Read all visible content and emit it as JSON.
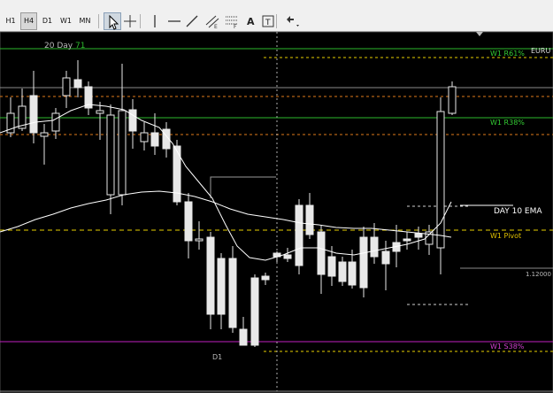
{
  "toolbar": {
    "timeframes": [
      "H1",
      "H4",
      "D1",
      "W1",
      "MN"
    ],
    "active_timeframe": "H4",
    "tools": [
      {
        "name": "cursor-icon",
        "active": true
      },
      {
        "name": "crosshair-icon",
        "active": false
      },
      {
        "name": "vertical-line-icon",
        "active": false
      },
      {
        "name": "horizontal-line-icon",
        "active": false
      },
      {
        "name": "trendline-icon",
        "active": false
      },
      {
        "name": "equidistant-channel-icon",
        "active": false
      },
      {
        "name": "fibonacci-icon",
        "active": false
      },
      {
        "name": "text-icon",
        "active": false
      },
      {
        "name": "text-label-icon",
        "active": false
      },
      {
        "name": "arrows-dropdown-icon",
        "active": false
      }
    ],
    "text_tool_glyph": "A"
  },
  "chart": {
    "top_label": "20 Day",
    "top_label_value": "71",
    "symbol_label": "EURU",
    "d1_label": "D1",
    "price_tick": "1.12000",
    "colors": {
      "background": "#000000",
      "candle": "#e8e8e8",
      "ema": "#ffffff",
      "sma20": "#ffffff",
      "green_level": "#2db82d",
      "magenta_level": "#c020c0",
      "orange_dotted": "#e07a1a",
      "yellow_dotted": "#e8d000",
      "white_dotted": "#cfcfcf",
      "grey_line": "#8a8a8a"
    },
    "levels": [
      {
        "label": "W1 R61%",
        "color": "#33cc33"
      },
      {
        "label": "W1 R38%",
        "color": "#33cc33"
      },
      {
        "label": "DAY 10 EMA",
        "color": "#ffffff"
      },
      {
        "label": "W1 Pivot",
        "color": "#e0c000"
      },
      {
        "label": "W1 S38%",
        "color": "#d040d0"
      }
    ]
  }
}
